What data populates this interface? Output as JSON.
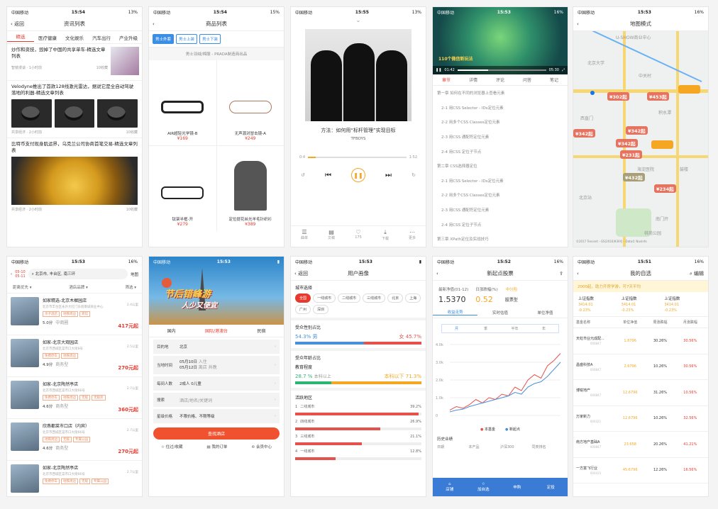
{
  "status": {
    "carrier": "中国移动",
    "t1": "15:54",
    "t2": "15:54",
    "t3": "15:55",
    "t4": "15:53",
    "t5": "15:53",
    "t6": "15:53",
    "t7": "15:53",
    "t8": "15:53",
    "t9": "15:52",
    "t10": "15:51",
    "bat1": "13%",
    "bat2": "15%",
    "bat3": "13%",
    "bat4": "16%",
    "bat5": "16%",
    "bat6": "16%",
    "bat9": "16%",
    "bat10": "16%"
  },
  "s1": {
    "back": "返回",
    "title": "资讯列表",
    "tabs": [
      "精选",
      "医疗健康",
      "文化娱乐",
      "汽车出行",
      "产业升级"
    ],
    "a1": {
      "title": "炒作和资技，毁掉了中国的共享单车-精选文章列表",
      "src": "智镜漫谈 · 1小时前",
      "cnt": "10收藏"
    },
    "a2": {
      "title": "Velodyne推出了首款128线激光雷达，据说它是全自动驾驶落地的利器-精选文章列表",
      "src": "共享经济 · 2小时前",
      "cnt": "10收藏"
    },
    "a3": {
      "title": "比特币支付现身肌运界，乌克兰公司协商首笔交易-精选文章列表",
      "src": "共享经济 · 2小时前",
      "cnt": "10收藏"
    }
  },
  "s2": {
    "title": "商品列表",
    "pills": [
      "男士外套",
      "男士上装",
      "男士下装"
    ],
    "banner": "男士羽绒/棉服 - PRADA制造商出品",
    "products": [
      {
        "name": "AIR超轻光学镜-B",
        "price": "¥169"
      },
      {
        "name": "无声源对冒击镜-A",
        "price": "¥249"
      },
      {
        "name": "钛架半框-开",
        "price": "¥279"
      },
      {
        "name": "定位提花丝光羊毛针织衫",
        "price": "¥389"
      }
    ]
  },
  "s3": {
    "song": "方法：如何用“标杆管理”实现目标",
    "artist": "TFBOYS",
    "cur": "0:4",
    "total": "1:52",
    "progress": 0.08,
    "bottom": [
      {
        "icon": "☰",
        "label": "曲单"
      },
      {
        "icon": "▤",
        "label": "文稿"
      },
      {
        "icon": "♡",
        "label": "175"
      },
      {
        "icon": "⤓",
        "label": "下载"
      },
      {
        "icon": "⋯",
        "label": "更多"
      }
    ]
  },
  "s4": {
    "vtime": "01:42",
    "vdur": "05:30",
    "vtext": "110个微信新玩法",
    "tabs": [
      "章节",
      "详情",
      "评论",
      "问答",
      "笔记"
    ],
    "items": [
      {
        "t": "第一章 如何在不同的浏览器上查看元素",
        "sub": false
      },
      {
        "t": "2-1 用CSS Selector - IDs定位元素",
        "sub": true
      },
      {
        "t": "2-2 用多个CSS Classes定位元素",
        "sub": true
      },
      {
        "t": "2-3 用CSS 通配符定位元素",
        "sub": true
      },
      {
        "t": "2-4 用CSS 定位子节点",
        "sub": true
      },
      {
        "t": "第二章 CSS选择器定位",
        "sub": false
      },
      {
        "t": "2-1 用CSS Selector - IDs定位元素",
        "sub": true
      },
      {
        "t": "2-2 用多个CSS Classes定位元素",
        "sub": true
      },
      {
        "t": "2-3 用CSS 通配符定位元素",
        "sub": true
      },
      {
        "t": "2-4 用CSS 定位子节点",
        "sub": true
      },
      {
        "t": "第三章 XPath定位及实战技巧",
        "sub": false
      }
    ]
  },
  "s5": {
    "title": "地图模式",
    "markers": [
      {
        "p": "¥302起",
        "c": "r"
      },
      {
        "p": "¥453起",
        "c": "r"
      },
      {
        "p": "¥234起",
        "c": "o"
      },
      {
        "p": "¥342起",
        "c": "r"
      },
      {
        "p": "¥342起",
        "c": "r"
      },
      {
        "p": "¥342起",
        "c": "r"
      },
      {
        "p": "¥205起",
        "c": "o"
      },
      {
        "p": "¥231起",
        "c": "r"
      },
      {
        "p": "¥432起",
        "c": "g"
      },
      {
        "p": "¥234起",
        "c": "r"
      }
    ],
    "places": [
      "U-SHOW商业中心",
      "北京大学",
      "中关村",
      "积水潭",
      "西直门",
      "海淀医院",
      "北京站",
      "桃苑公园",
      "鼓楼",
      "南门开"
    ],
    "copyright": "©2017 Tencent - GS(2016)930号 - Data© NavInfo"
  },
  "s6": {
    "dates": [
      "05-10",
      "05-11"
    ],
    "search": "北京市, 丰台区, 南三环",
    "mapbtn": "地图",
    "filters": [
      "距离优先",
      "酒店品牌",
      "筛选"
    ],
    "hotels": [
      {
        "name": "如家精选-北京木樨园店",
        "addr": "北京市丰台区永外大红门东街南城商业中心",
        "dist": "2.4公里",
        "score": "5.0分",
        "tag": "中商圈",
        "price": "417元起",
        "tags": [
          "亲子酒店",
          "地铁周边",
          "宾馆"
        ]
      },
      {
        "name": "如家-北京大观园店",
        "addr": "北京市西城区菜市口大街8号",
        "dist": "2.5公里",
        "score": "4.9分",
        "tag": "商务型",
        "price": "270元起",
        "tags": [
          "免费停车",
          "地铁周边"
        ]
      },
      {
        "name": "如家-北京陶然亭店",
        "addr": "北京市西城区菜市口大街66号",
        "dist": "2.7公里",
        "score": "4.6分",
        "tag": "商务型",
        "price": "360元起",
        "tags": [
          "免费停车",
          "地铁周边",
          "无敌",
          "无敌旁"
        ]
      },
      {
        "name": "欣燕都菜市口店（内宾）",
        "addr": "北京市西城区菜市口大街66号",
        "dist": "2.7公里",
        "score": "4.6分",
        "tag": "商务型",
        "price": "270元起",
        "tags": [
          "地铁周边",
          "无敌",
          "专属公园"
        ]
      },
      {
        "name": "如家-北京陶然亭店",
        "addr": "北京市西城区菜市口大街66号",
        "dist": "2.7公里",
        "score": "",
        "tag": "",
        "price": "",
        "tags": [
          "免费停车",
          "地铁周边",
          "无敌",
          "专属公园"
        ]
      }
    ]
  },
  "s7": {
    "h1": "节后错峰游",
    "h2": "人少又便宜",
    "tabs": [
      "国内",
      "国际/港澳台",
      "民宿"
    ],
    "dest_l": "目的地",
    "dest_v": "北京",
    "time_l": "当地时间",
    "time_v1": "05月10日",
    "time_s1": "入住",
    "time_v2": "05月12日",
    "time_s2": "离店 共晚",
    "room_l": "每间人数",
    "room_v": "2成人 0儿童",
    "search_l": "搜索",
    "search_v": "酒店/地名/关键词",
    "star_l": "星级价格",
    "star_v": "不限价格、不限等级",
    "btn": "查找酒店",
    "links": [
      "住过/收藏",
      "我的订单",
      "会员中心"
    ]
  },
  "s8": {
    "back": "返回",
    "title": "用户画像",
    "city_h": "城市选择",
    "cities": [
      "全国",
      "一线城市",
      "二线城市",
      "三线城市",
      "北京",
      "上海",
      "广州",
      "深圳"
    ],
    "gender_h": "受众性别占比",
    "male": "54.3% 男",
    "female": "女 45.7%",
    "male_frac": 0.543,
    "age_h": "受众年龄占比",
    "edu_h": "教育程度",
    "edu_l": "28.7 %",
    "edu_l_s": "本科以上",
    "edu_r": "本科以下 71.3%",
    "edu_frac": 0.287,
    "region_h": "活跃地区",
    "regions": [
      {
        "n": "1",
        "name": "二线城市",
        "v": 39.2
      },
      {
        "n": "2",
        "name": "四线城市",
        "v": 26.9
      },
      {
        "n": "3",
        "name": "三线城市",
        "v": 21.1
      },
      {
        "n": "4",
        "name": "一线城市",
        "v": 12.8
      }
    ],
    "colors": {
      "male": "#4a90d9",
      "female": "#e5514b",
      "edu": "#2bb673",
      "eduB": "#f5a623"
    }
  },
  "s9": {
    "title": "新起点股票",
    "nav_l": "最新净值(01-12)",
    "nav_v": "1.5370",
    "chg_l": "日涨跌幅(%)",
    "chg_v": "0.52",
    "risk": "中分险",
    "type": "股票型",
    "tabs": [
      "收益走势",
      "实时估值",
      "单位净值"
    ],
    "range": [
      "月",
      "季",
      "半年",
      "年"
    ],
    "legend": [
      "本基金",
      "新起点"
    ],
    "hist": "历史业绩",
    "th": [
      "日期",
      "本产品",
      "沪深300",
      "同类排名"
    ],
    "bottom": [
      {
        "icon": "⌂",
        "label": "店铺"
      },
      {
        "icon": "☆",
        "label": "加自选"
      },
      {
        "icon": "",
        "label": "申购"
      },
      {
        "icon": "",
        "label": "定投"
      }
    ],
    "chart_data": {
      "type": "line",
      "ylim": [
        0,
        4
      ],
      "yticks": [
        "0",
        "1.0k",
        "2.0k",
        "3.0k",
        "4.0k"
      ],
      "series": [
        {
          "name": "本基金",
          "color": "#e5514b",
          "values": [
            0.3,
            0.5,
            0.4,
            0.6,
            0.9,
            0.7,
            1.0,
            0.9,
            1.2,
            1.1,
            1.6,
            1.4,
            2.0,
            2.3,
            2.1,
            2.8,
            3.1,
            3.5
          ]
        },
        {
          "name": "新起点",
          "color": "#4a90d9",
          "values": [
            0.2,
            0.3,
            0.35,
            0.5,
            0.6,
            0.7,
            0.8,
            0.9,
            1.0,
            1.1,
            1.3,
            1.2,
            1.6,
            1.8,
            1.9,
            2.2,
            2.6,
            3.0
          ]
        }
      ]
    }
  },
  "s10": {
    "title": "我的自选",
    "edit": "编辑",
    "notice": "2000起，助力开房学游，可7天平均",
    "idx": [
      {
        "n": "上证指数",
        "v": "3414.01",
        "c": "-0.23%"
      },
      {
        "n": "上证指数",
        "v": "3414.01",
        "c": "-0.23%"
      },
      {
        "n": "上证指数",
        "v": "3414.01",
        "c": "-0.23%"
      }
    ],
    "th": [
      "基金名称",
      "单位净值",
      "周涨跌幅",
      "月涨跌幅"
    ],
    "rows": [
      {
        "n": "天虹市业元成配...",
        "c": "000847",
        "a": "1.6796",
        "b": "30.26%",
        "d": "30.56%"
      },
      {
        "n": "昌盛科技A",
        "c": "000847",
        "a": "2.6796",
        "b": "10.26%",
        "d": "30.56%"
      },
      {
        "n": "博锐地产",
        "c": "000847",
        "a": "12.6796",
        "b": "31.26%",
        "d": "10.56%"
      },
      {
        "n": "万家新力",
        "c": "000321",
        "a": "12.6796",
        "b": "10.26%",
        "d": "32.56%"
      },
      {
        "n": "南方地产基础A",
        "c": "000847",
        "a": "23.658",
        "b": "20.26%",
        "d": "41.21%"
      },
      {
        "n": "一方富飞行业",
        "c": "000415",
        "a": "45.6796",
        "b": "12.26%",
        "d": "16.56%"
      }
    ]
  }
}
